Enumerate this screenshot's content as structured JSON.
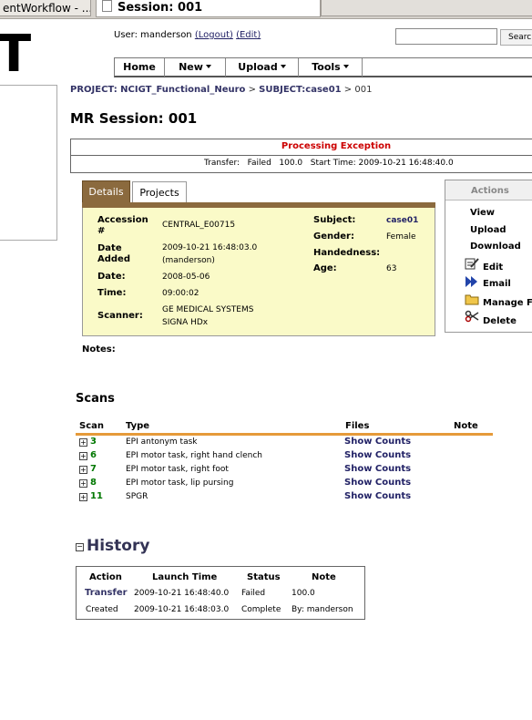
{
  "browser": {
    "tab1": "entWorkflow - ...",
    "tab2": "Session: 001"
  },
  "logo_fragment": "T",
  "user": {
    "prefix": "User: manderson",
    "logout": "(Logout)",
    "edit": "(Edit)"
  },
  "search": {
    "placeholder": "",
    "button": "Searc"
  },
  "nav": [
    "Home",
    "New",
    "Upload",
    "Tools"
  ],
  "breadcrumb": {
    "project": "PROJECT: NCIGT_Functional_Neuro",
    "sep1": ">",
    "subject": "SUBJECT:case01",
    "sep2": ">",
    "session": "001"
  },
  "title": "MR Session: 001",
  "exception": {
    "title": "Processing Exception",
    "label": "Transfer:",
    "status": "Failed",
    "value": "100.0",
    "start": "Start Time: 2009-10-21 16:48:40.0"
  },
  "tabs": {
    "details": "Details",
    "projects": "Projects"
  },
  "details": {
    "accession_label": "Accession #",
    "accession": "CENTRAL_E00715",
    "date_added_label": "Date Added",
    "date_added": "2009-10-21 16:48:03.0",
    "date_added_by": "(manderson)",
    "date_label": "Date:",
    "date": "2008-05-06",
    "time_label": "Time:",
    "time": "09:00:02",
    "scanner_label": "Scanner:",
    "scanner_1": "GE MEDICAL SYSTEMS",
    "scanner_2": "SIGNA HDx",
    "subject_label": "Subject:",
    "subject": "case01",
    "gender_label": "Gender:",
    "gender": "Female",
    "handedness_label": "Handedness:",
    "handedness": "",
    "age_label": "Age:",
    "age": "63"
  },
  "actions": {
    "title": "Actions",
    "view": "View",
    "upload": "Upload",
    "download": "Download",
    "edit": "Edit",
    "email": "Email",
    "manage": "Manage Fi",
    "delete": "Delete"
  },
  "notes_label": "Notes:",
  "scans": {
    "heading": "Scans",
    "headers": {
      "scan": "Scan",
      "type": "Type",
      "files": "Files",
      "note": "Note"
    },
    "rows": [
      {
        "id": "3",
        "type": "EPI antonym task",
        "files": "Show Counts"
      },
      {
        "id": "6",
        "type": "EPI motor task, right hand clench",
        "files": "Show Counts"
      },
      {
        "id": "7",
        "type": "EPI motor task, right foot",
        "files": "Show Counts"
      },
      {
        "id": "8",
        "type": "EPI motor task, lip pursing",
        "files": "Show Counts"
      },
      {
        "id": "11",
        "type": "SPGR",
        "files": "Show Counts"
      }
    ]
  },
  "history": {
    "toggle": "−",
    "heading": "History",
    "headers": {
      "action": "Action",
      "launch": "Launch Time",
      "status": "Status",
      "note": "Note"
    },
    "rows": [
      {
        "action": "Transfer",
        "launch": "2009-10-21 16:48:40.0",
        "status": "Failed",
        "note": "100.0"
      },
      {
        "action": "Created",
        "launch": "2009-10-21 16:48:03.0",
        "status": "Complete",
        "note": "By: manderson"
      }
    ]
  },
  "colors": {
    "details_tab": "#8b6a3e",
    "details_bg": "#fafac8",
    "exception_red": "#cc0000",
    "scan_id_green": "#007700",
    "link_blue": "#222266",
    "divider_orange": "#e59a3a"
  }
}
